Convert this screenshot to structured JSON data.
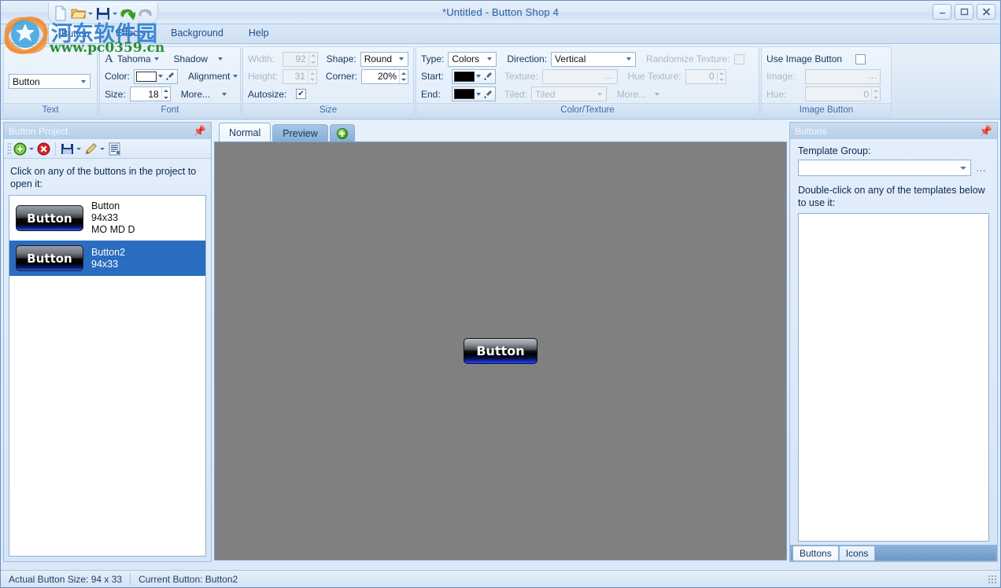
{
  "window": {
    "title": "*Untitled - Button Shop 4",
    "minimize": "–",
    "maximize": "❐",
    "close": "✕"
  },
  "quick_access": {
    "items": [
      {
        "name": "new-icon",
        "label": "New"
      },
      {
        "name": "open-icon",
        "label": "Open"
      },
      {
        "name": "save-icon",
        "label": "Save"
      },
      {
        "name": "undo-icon",
        "label": "Undo"
      },
      {
        "name": "redo-icon",
        "label": "Redo"
      }
    ]
  },
  "menu_tabs": [
    {
      "label": "Button",
      "active": true
    },
    {
      "label": "Effects",
      "active": false
    },
    {
      "label": "Background",
      "active": false
    },
    {
      "label": "Help",
      "active": false
    }
  ],
  "ribbon": {
    "text_group": {
      "label": "Text",
      "text_value": "Button"
    },
    "font_group": {
      "label": "Font",
      "font_name": "Tahoma",
      "color_label": "Color:",
      "color_value": "#ffffff",
      "size_label": "Size:",
      "size_value": "18",
      "shadow_label": "Shadow",
      "alignment_label": "Alignment",
      "more_label": "More..."
    },
    "size_group": {
      "label": "Size",
      "width_label": "Width:",
      "width_value": "92",
      "height_label": "Height:",
      "height_value": "31",
      "autosize_label": "Autosize:",
      "autosize_checked": true,
      "shape_label": "Shape:",
      "shape_value": "Round",
      "corner_label": "Corner:",
      "corner_value": "20%"
    },
    "color_group": {
      "label": "Color/Texture",
      "type_label": "Type:",
      "type_value": "Colors",
      "start_label": "Start:",
      "start_value": "#000000",
      "end_label": "End:",
      "end_value": "#000000",
      "direction_label": "Direction:",
      "direction_value": "Vertical",
      "texture_label": "Texture:",
      "texture_value": "",
      "tiled_label": "Tiled:",
      "tiled_value": "Tiled",
      "randomize_label": "Randomize Texture:",
      "randomize_checked": false,
      "hue_texture_label": "Hue Texture:",
      "hue_texture_value": "0",
      "more_label": "More..."
    },
    "image_group": {
      "label": "Image Button",
      "use_image_label": "Use Image Button",
      "use_image_checked": false,
      "image_label": "Image:",
      "image_value": "",
      "hue_label": "Hue:",
      "hue_value": "0"
    }
  },
  "left_panel": {
    "title": "Button Project",
    "toolbar": [
      {
        "name": "add-button-icon"
      },
      {
        "name": "delete-button-icon"
      },
      {
        "name": "save-project-icon"
      },
      {
        "name": "wand-icon"
      },
      {
        "name": "list-icon"
      }
    ],
    "hint": "Click on any of the buttons in the project to open it:",
    "items": [
      {
        "preview_text": "Button",
        "name": "Button",
        "size": "94x33",
        "states": "MO MD D",
        "selected": false
      },
      {
        "preview_text": "Button",
        "name": "Button2",
        "size": "94x33",
        "states": "",
        "selected": true
      }
    ]
  },
  "center": {
    "tabs": [
      {
        "label": "Normal",
        "active": true
      },
      {
        "label": "Preview",
        "active": false
      }
    ],
    "add_tab_icon": "plus-circle-icon",
    "canvas_background": "#808080",
    "button_text": "Button"
  },
  "right_panel": {
    "title": "Buttons",
    "template_group_label": "Template Group:",
    "template_group_value": "",
    "ellipsis_label": "...",
    "hint": "Double-click on any of the templates below to use it:",
    "tabs": [
      {
        "label": "Buttons",
        "active": true
      },
      {
        "label": "Icons",
        "active": false
      }
    ]
  },
  "status_bar": {
    "actual_size": "Actual Button Size:  94 x 33",
    "current_button": "Current Button:  Button2"
  },
  "watermark": {
    "chinese": "河东软件园",
    "url": "www.pc0359.cn"
  }
}
